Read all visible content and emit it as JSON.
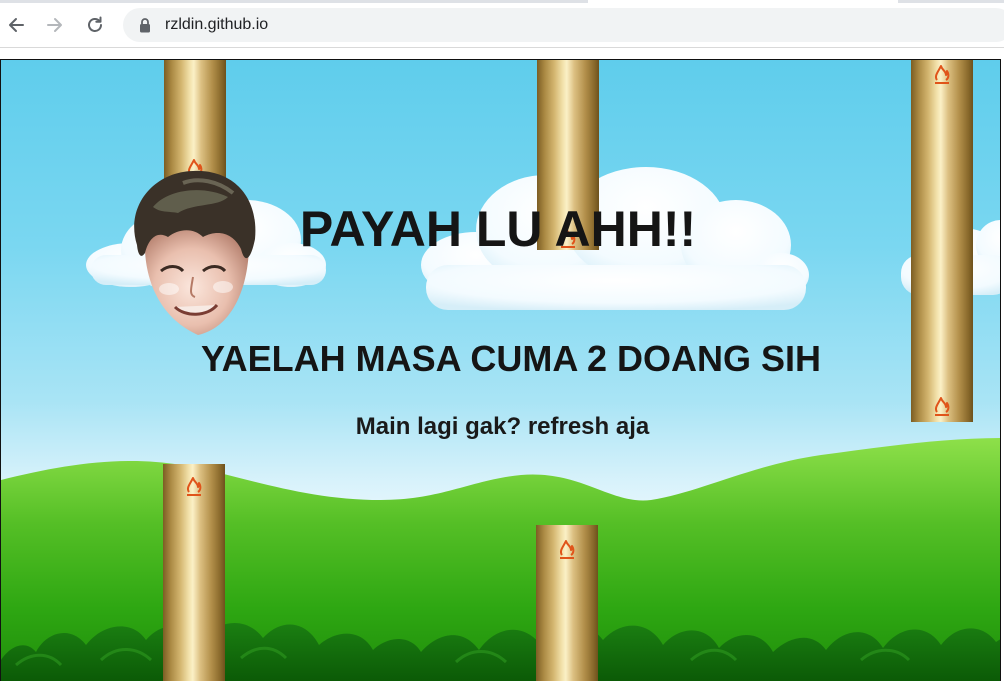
{
  "browser": {
    "url": "rzldin.github.io",
    "back_icon": "back-arrow-icon",
    "forward_icon": "forward-arrow-icon",
    "reload_icon": "reload-icon",
    "lock_icon": "lock-icon"
  },
  "game": {
    "title": "PAYAH LU AHH!!",
    "score_message": "YAELAH MASA CUMA 2 DOANG SIH",
    "hint": "Main lagi gak? refresh aja",
    "player": "player-face",
    "pipe_logo": "fire-logo-icon",
    "colors": {
      "sky_top": "#5fcdec",
      "sky_bottom": "#e9f8fd",
      "grass": "#3cae1c",
      "dark_bushes": "#0f6a0a",
      "pipe_gold": "#d4b670",
      "text": "#151515"
    }
  }
}
